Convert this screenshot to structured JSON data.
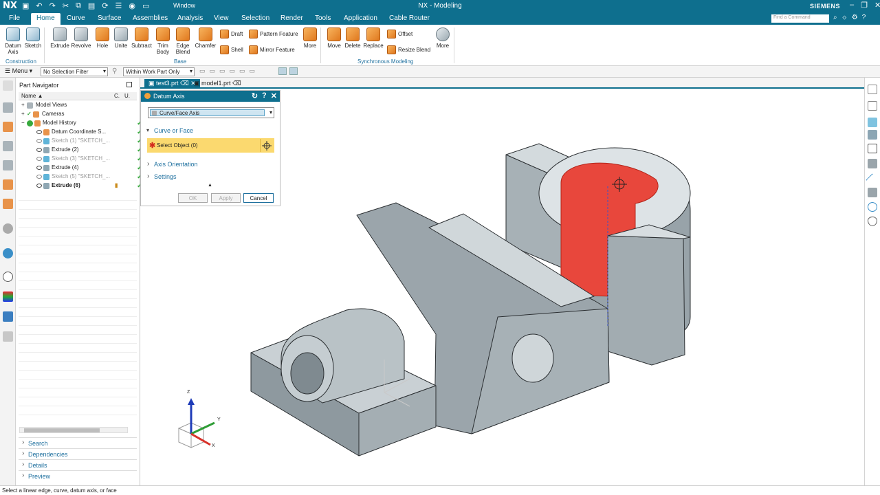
{
  "app": {
    "logo": "NX",
    "title": "NX - Modeling",
    "window_menu": "Window",
    "brand": "SIEMENS"
  },
  "menu": {
    "tabs": [
      "File",
      "Home",
      "Curve",
      "Surface",
      "Assemblies",
      "Analysis",
      "View",
      "Selection",
      "Render",
      "Tools",
      "Application",
      "Cable Router"
    ],
    "active": "Home",
    "search_placeholder": "Find a Command"
  },
  "ribbon": {
    "construction": {
      "datum_axis": "Datum Axis",
      "sketch": "Sketch",
      "group": "Construction"
    },
    "base": {
      "extrude": "Extrude",
      "revolve": "Revolve",
      "hole": "Hole",
      "unite": "Unite",
      "subtract": "Subtract",
      "trim_body": "Trim Body",
      "edge_blend": "Edge Blend",
      "chamfer": "Chamfer",
      "draft": "Draft",
      "shell": "Shell",
      "pattern_feature": "Pattern Feature",
      "mirror_feature": "Mirror Feature",
      "more": "More",
      "group": "Base"
    },
    "sync": {
      "move": "Move",
      "delete": "Delete",
      "replace": "Replace",
      "offset": "Offset",
      "resize_blend": "Resize Blend",
      "more": "More",
      "group": "Synchronous Modeling"
    }
  },
  "toolbar": {
    "menu_label": "Menu",
    "selection_filter": "No Selection Filter",
    "scope": "Within Work Part Only"
  },
  "navigator": {
    "title": "Part Navigator",
    "columns": {
      "name": "Name",
      "c": "C.",
      "u": "U."
    },
    "items": [
      {
        "label": "Model Views"
      },
      {
        "label": "Cameras"
      },
      {
        "label": "Model History"
      },
      {
        "label": "Datum Coordinate S..."
      },
      {
        "label": "Sketch (1) \"SKETCH_..."
      },
      {
        "label": "Extrude (2)"
      },
      {
        "label": "Sketch (3) \"SKETCH_..."
      },
      {
        "label": "Extrude (4)"
      },
      {
        "label": "Sketch (5) \"SKETCH_..."
      },
      {
        "label": "Extrude (6)"
      }
    ],
    "panels": [
      "Search",
      "Dependencies",
      "Details",
      "Preview"
    ]
  },
  "doc_tabs": [
    "test3.prt",
    "model1.prt"
  ],
  "dialog": {
    "title": "Datum Axis",
    "type_value": "Curve/Face Axis",
    "section_curve": "Curve or Face",
    "select_object": "Select Object (0)",
    "section_orientation": "Axis Orientation",
    "section_settings": "Settings",
    "ok": "OK",
    "apply": "Apply",
    "cancel": "Cancel"
  },
  "triad": {
    "x": "X",
    "y": "Y",
    "z": "Z"
  },
  "status": "Select a linear edge, curve, datum axis, or face",
  "colors": {
    "brand": "#0e6f8e",
    "highlight": "#e8473c",
    "model_gray": "#a7b1b6",
    "prompt_yellow": "#fbd96f"
  }
}
